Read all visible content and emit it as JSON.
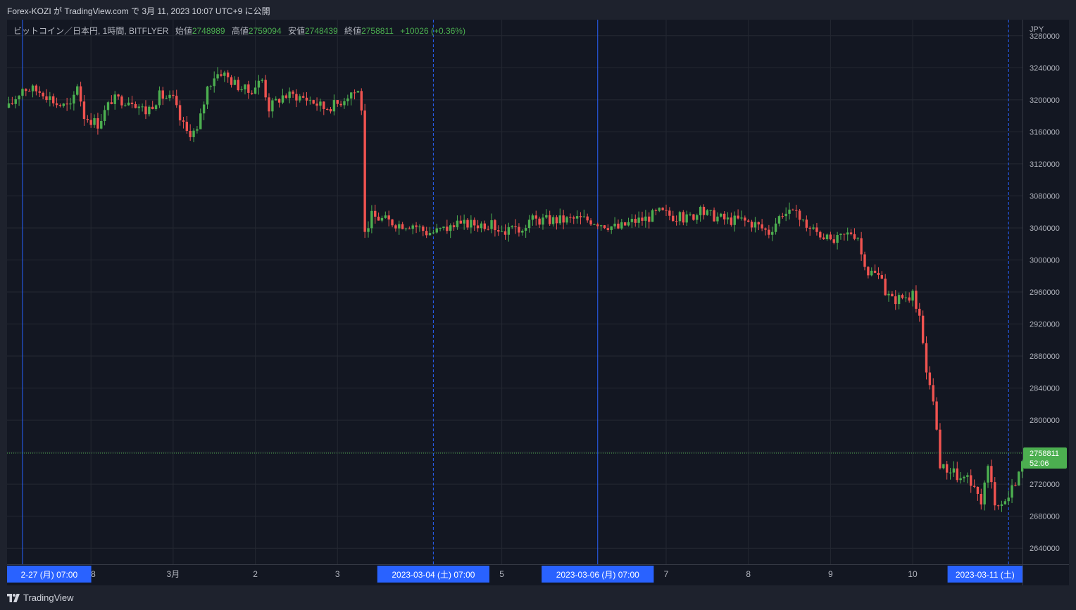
{
  "header": {
    "published_text": "Forex-KOZI が TradingView.com で 3月 11, 2023 10:07 UTC+9 に公開"
  },
  "legend": {
    "symbol": "ビットコイン／日本円, 1時間, BITFLYER",
    "open_label": "始値",
    "open": "2748989",
    "high_label": "高値",
    "high": "2759094",
    "low_label": "安値",
    "low": "2748439",
    "close_label": "終値",
    "close": "2758811",
    "change": "+10026 (+0.36%)"
  },
  "price_axis": {
    "currency": "JPY",
    "ticks": [
      3280000,
      3240000,
      3200000,
      3160000,
      3120000,
      3080000,
      3040000,
      3000000,
      2960000,
      2920000,
      2880000,
      2840000,
      2800000,
      2760000,
      2720000,
      2680000,
      2640000
    ],
    "last_price": "2758811",
    "countdown": "52:06"
  },
  "time_axis": {
    "ticks": [
      {
        "label": "28",
        "t": 24
      },
      {
        "label": "3月",
        "t": 48
      },
      {
        "label": "2",
        "t": 72
      },
      {
        "label": "3",
        "t": 96
      },
      {
        "label": "5",
        "t": 144
      },
      {
        "label": "7",
        "t": 192
      },
      {
        "label": "8",
        "t": 216
      },
      {
        "label": "9",
        "t": 240
      },
      {
        "label": "10",
        "t": 264
      }
    ],
    "highlighted": [
      {
        "label": "2-27 (月)   07:00",
        "t": 4
      },
      {
        "label": "2023-03-04 (土)   07:00",
        "t": 124
      },
      {
        "label": "2023-03-06 (月)   07:00",
        "t": 172
      },
      {
        "label": "2023-03-11 (土)",
        "t": 292
      }
    ]
  },
  "markers": [
    {
      "t": 4,
      "style": "solid"
    },
    {
      "t": 124,
      "style": "dashed"
    },
    {
      "t": 172,
      "style": "solid"
    },
    {
      "t": 292,
      "style": "dashed"
    }
  ],
  "footer": {
    "brand": "TradingView"
  },
  "colors": {
    "background": "#131722",
    "up": "#4caf50",
    "down": "#f05350",
    "grid": "#242832",
    "marker": "#2962ff",
    "label_bg": "#2962ff"
  },
  "chart_data": {
    "type": "candlestick",
    "title": "ビットコイン／日本円, 1時間, BITFLYER",
    "ylabel": "JPY",
    "ylim": [
      2620000,
      3300000
    ],
    "x_unit": "hours from 2023-02-27 03:00 (UTC+9)",
    "xlim": [
      0,
      298
    ],
    "anchors": [
      [
        0,
        3190000
      ],
      [
        4,
        3215000
      ],
      [
        10,
        3210000
      ],
      [
        14,
        3195000
      ],
      [
        18,
        3190000
      ],
      [
        20,
        3220000
      ],
      [
        22,
        3180000
      ],
      [
        26,
        3170000
      ],
      [
        30,
        3200000
      ],
      [
        36,
        3200000
      ],
      [
        40,
        3185000
      ],
      [
        44,
        3205000
      ],
      [
        48,
        3200000
      ],
      [
        50,
        3175000
      ],
      [
        52,
        3160000
      ],
      [
        55,
        3160000
      ],
      [
        58,
        3215000
      ],
      [
        60,
        3230000
      ],
      [
        62,
        3235000
      ],
      [
        66,
        3220000
      ],
      [
        70,
        3210000
      ],
      [
        74,
        3225000
      ],
      [
        76,
        3190000
      ],
      [
        80,
        3205000
      ],
      [
        84,
        3205000
      ],
      [
        88,
        3200000
      ],
      [
        92,
        3190000
      ],
      [
        96,
        3195000
      ],
      [
        100,
        3210000
      ],
      [
        102,
        3210000
      ],
      [
        103,
        3190000
      ],
      [
        104,
        3035000
      ],
      [
        106,
        3055000
      ],
      [
        110,
        3050000
      ],
      [
        114,
        3045000
      ],
      [
        118,
        3045000
      ],
      [
        122,
        3035000
      ],
      [
        124,
        3035000
      ],
      [
        128,
        3040000
      ],
      [
        134,
        3045000
      ],
      [
        140,
        3045000
      ],
      [
        144,
        3038000
      ],
      [
        148,
        3035000
      ],
      [
        152,
        3050000
      ],
      [
        156,
        3050000
      ],
      [
        162,
        3050000
      ],
      [
        166,
        3052000
      ],
      [
        170,
        3050000
      ],
      [
        174,
        3045000
      ],
      [
        178,
        3040000
      ],
      [
        182,
        3048000
      ],
      [
        186,
        3052000
      ],
      [
        190,
        3060000
      ],
      [
        194,
        3055000
      ],
      [
        198,
        3052000
      ],
      [
        202,
        3060000
      ],
      [
        206,
        3055000
      ],
      [
        210,
        3050000
      ],
      [
        214,
        3050000
      ],
      [
        218,
        3045000
      ],
      [
        222,
        3035000
      ],
      [
        226,
        3060000
      ],
      [
        230,
        3055000
      ],
      [
        234,
        3040000
      ],
      [
        238,
        3030000
      ],
      [
        240,
        3020000
      ],
      [
        244,
        3030000
      ],
      [
        246,
        3035000
      ],
      [
        248,
        3030000
      ],
      [
        250,
        2985000
      ],
      [
        252,
        2985000
      ],
      [
        254,
        2980000
      ],
      [
        256,
        2960000
      ],
      [
        258,
        2950000
      ],
      [
        262,
        2955000
      ],
      [
        264,
        2955000
      ],
      [
        266,
        2925000
      ],
      [
        268,
        2860000
      ],
      [
        270,
        2830000
      ],
      [
        272,
        2740000
      ],
      [
        274,
        2740000
      ],
      [
        276,
        2735000
      ],
      [
        278,
        2725000
      ],
      [
        280,
        2725000
      ],
      [
        282,
        2710000
      ],
      [
        284,
        2700000
      ],
      [
        286,
        2740000
      ],
      [
        288,
        2700000
      ],
      [
        290,
        2695000
      ],
      [
        292,
        2705000
      ],
      [
        294,
        2725000
      ],
      [
        296,
        2745000
      ],
      [
        298,
        2758811
      ]
    ]
  }
}
